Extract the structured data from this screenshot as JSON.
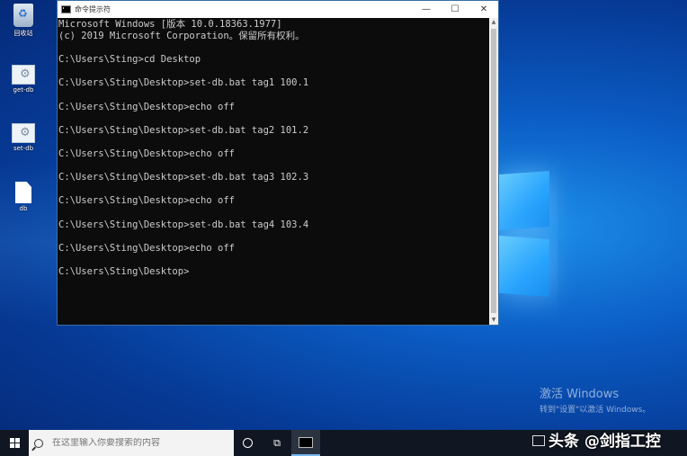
{
  "desktop": {
    "icons": [
      {
        "label": "回收站",
        "icon": "recycle-bin-icon"
      },
      {
        "label": "get-db",
        "icon": "batch-file-icon"
      },
      {
        "label": "set-db",
        "icon": "batch-file-icon"
      },
      {
        "label": "db",
        "icon": "text-file-icon"
      }
    ]
  },
  "cmd": {
    "title": "命令提示符",
    "minimize": "—",
    "maximize": "☐",
    "close": "✕",
    "lines": [
      "Microsoft Windows [版本 10.0.18363.1977]",
      "(c) 2019 Microsoft Corporation。保留所有权利。",
      "",
      "C:\\Users\\Sting>cd Desktop",
      "",
      "C:\\Users\\Sting\\Desktop>set-db.bat tag1 100.1",
      "",
      "C:\\Users\\Sting\\Desktop>echo off",
      "",
      "C:\\Users\\Sting\\Desktop>set-db.bat tag2 101.2",
      "",
      "C:\\Users\\Sting\\Desktop>echo off",
      "",
      "C:\\Users\\Sting\\Desktop>set-db.bat tag3 102.3",
      "",
      "C:\\Users\\Sting\\Desktop>echo off",
      "",
      "C:\\Users\\Sting\\Desktop>set-db.bat tag4 103.4",
      "",
      "C:\\Users\\Sting\\Desktop>echo off",
      "",
      "C:\\Users\\Sting\\Desktop>"
    ]
  },
  "watermark": {
    "line1": "激活 Windows",
    "line2": "转到\"设置\"以激活 Windows。"
  },
  "taskbar": {
    "search_placeholder": "在这里输入你要搜索的内容",
    "taskview_glyph": "⧉"
  },
  "overlay": {
    "brand": "头条 @剑指工控"
  },
  "colors": {
    "console_bg": "#0c0c0c",
    "console_fg": "#cccccc",
    "taskbar_bg": "#101722"
  }
}
